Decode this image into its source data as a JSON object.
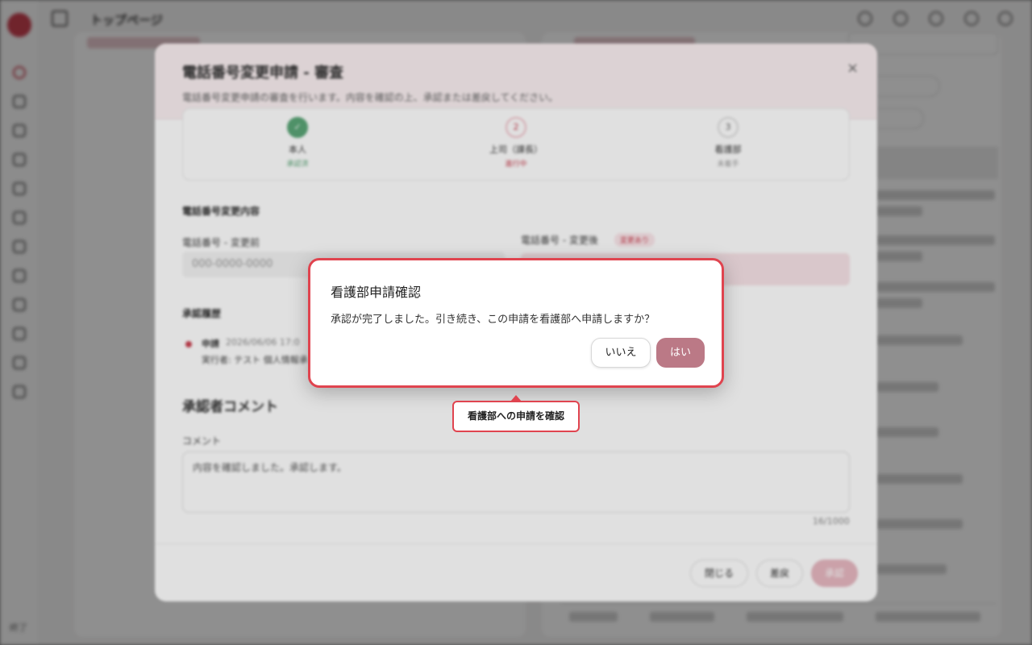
{
  "app": {
    "title": "トップページ",
    "footer_label": "終了"
  },
  "review_modal": {
    "title": "電話番号変更申請 - 審査",
    "subtitle": "電話番号変更申請の審査を行います。内容を確認の上、承認または差戻してください。",
    "close_icon": "×",
    "steps": [
      {
        "marker": "✓",
        "name": "本人",
        "status": "承認済"
      },
      {
        "marker": "2",
        "name": "上司（課長）",
        "status": "進行中"
      },
      {
        "marker": "3",
        "name": "看護部",
        "status": "未着手"
      }
    ],
    "section_change": "電話番号変更内容",
    "old_label": "電話番号 - 変更前",
    "old_value": "000-0000-0000",
    "new_label": "電話番号 - 変更後",
    "new_badge": "変更あり",
    "section_history": "承認履歴",
    "history": [
      {
        "kind": "申請",
        "date": "2026/06/06 17:0"
      },
      {
        "actor": "実行者: テスト 個人情報承"
      }
    ],
    "comment_title": "承認者コメント",
    "comment_label": "コメント",
    "comment_value": "内容を確認しました。承認します。",
    "char_count": "16/1000",
    "buttons": {
      "close": "閉じる",
      "reject": "差戻",
      "approve": "承認"
    }
  },
  "confirm_dialog": {
    "title": "看護部申請確認",
    "message": "承認が完了しました。引き続き、この申請を看護部へ申請しますか？",
    "no_label": "いいえ",
    "yes_label": "はい"
  },
  "callout": {
    "label": "看護部への申請を確認"
  },
  "colors": {
    "accent": "#c94050",
    "dialog_border": "#e0444f",
    "yes_button": "#bb7986",
    "done_step": "#5aa677"
  }
}
